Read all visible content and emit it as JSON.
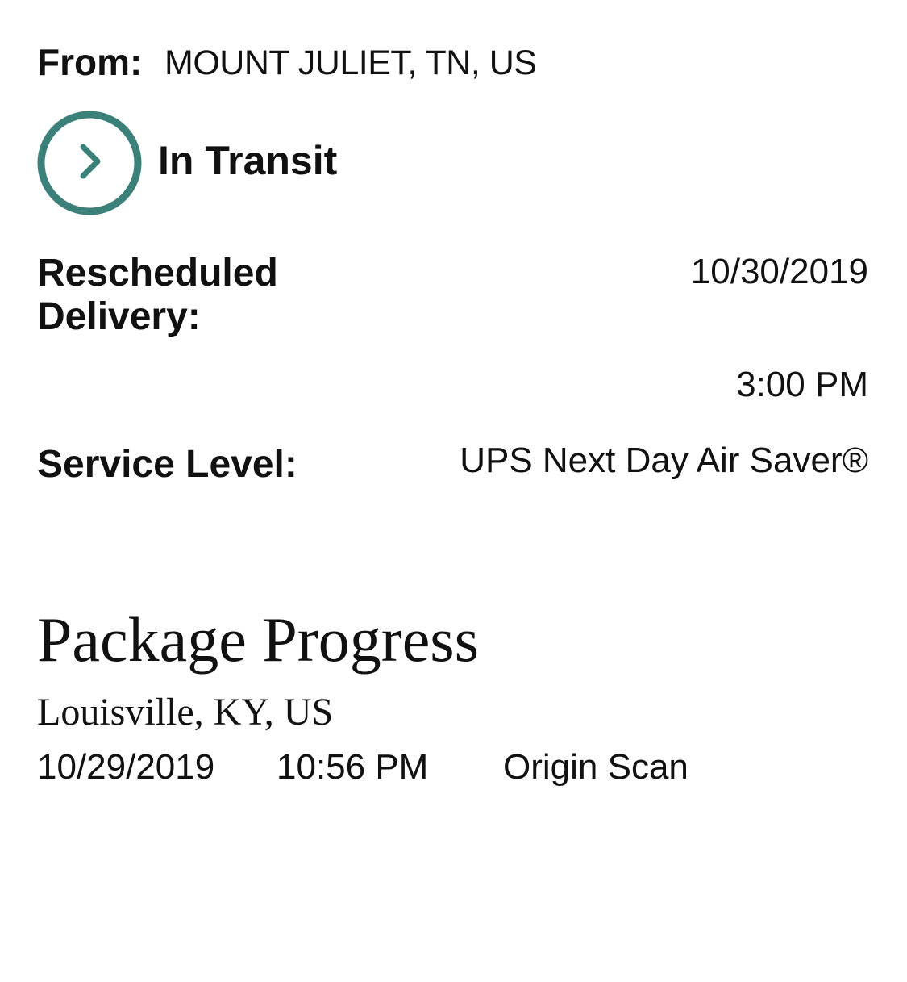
{
  "shipment": {
    "from_label": "From:",
    "from_value": "MOUNT JULIET, TN, US",
    "status": "In Transit",
    "status_icon": "chevron-right-circle-icon",
    "accent_color": "#3b8179",
    "rescheduled_label": "Rescheduled Delivery:",
    "rescheduled_date": "10/30/2019",
    "rescheduled_time": "3:00 PM",
    "service_label": "Service Level:",
    "service_value": "UPS Next Day Air Saver®"
  },
  "progress": {
    "title": "Package Progress",
    "events": [
      {
        "location": "Louisville, KY, US",
        "date": "10/29/2019",
        "time": "10:56 PM",
        "activity": "Origin Scan"
      }
    ]
  }
}
